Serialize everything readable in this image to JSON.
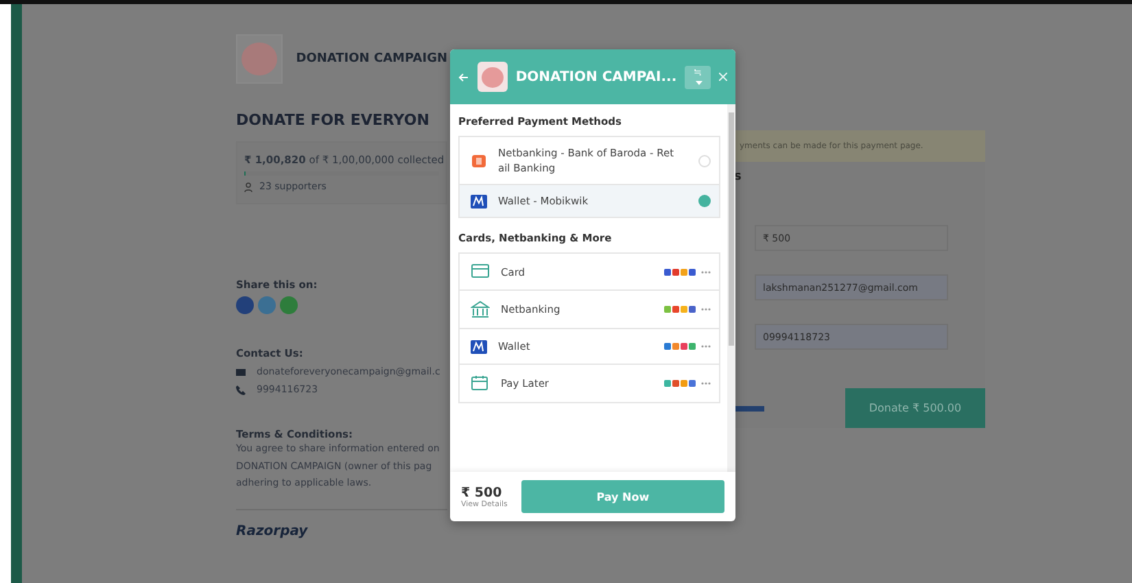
{
  "page": {
    "campaign_name": "DONATION CAMPAIGN",
    "heading": "DONATE FOR EVERYON",
    "progress": {
      "raised": "₹ 1,00,820",
      "of_text": "of ₹ 1,00,00,000 collected",
      "level": 0.01,
      "supporters": "23 supporters"
    },
    "share_label": "Share this on:",
    "contact_label": "Contact Us:",
    "email": "donateforeveryonecampaign@gmail.c",
    "phone": "9994116723",
    "terms_label": "Terms & Conditions:",
    "terms_lines": [
      "You agree to share information entered on",
      "DONATION CAMPAIGN (owner of this pag",
      "adhering to applicable laws."
    ],
    "brand": "Razorpay"
  },
  "form": {
    "notice": "yments can be made for this payment page.",
    "heading": "s",
    "fields": [
      {
        "value": "₹ 500"
      },
      {
        "value": "lakshmanan251277@gmail.com"
      },
      {
        "value": "09994118723"
      }
    ],
    "donate_button": "Donate  ₹ 500.00"
  },
  "checkout": {
    "title": "DONATION CAMPAI...",
    "language": "≒",
    "preferred_heading": "Preferred Payment Methods",
    "preferred": [
      {
        "kind": "bank",
        "label": "Netbanking - Bank of Baroda - Ret ail Banking",
        "selected": false
      },
      {
        "kind": "wallet",
        "label": "Wallet - Mobikwik",
        "selected": true
      }
    ],
    "more_heading": "Cards, Netbanking & More",
    "methods": [
      {
        "kind": "card",
        "label": "Card"
      },
      {
        "kind": "netbanking",
        "label": "Netbanking"
      },
      {
        "kind": "wallet",
        "label": "Wallet"
      },
      {
        "kind": "paylater",
        "label": "Pay Later"
      }
    ],
    "amount": "₹ 500",
    "details_link": "View Details",
    "pay_button": "Pay Now"
  }
}
